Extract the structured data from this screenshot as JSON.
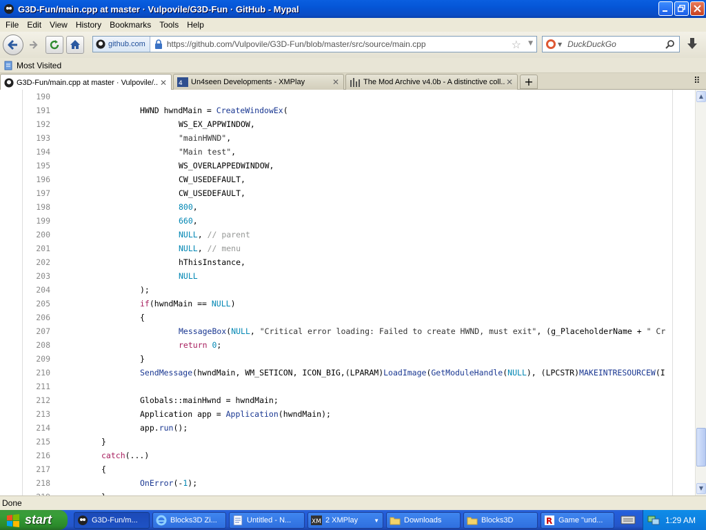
{
  "window": {
    "title": "G3D-Fun/main.cpp at master · Vulpovile/G3D-Fun · GitHub - Mypal"
  },
  "menu": [
    "File",
    "Edit",
    "View",
    "History",
    "Bookmarks",
    "Tools",
    "Help"
  ],
  "nav": {
    "identity": "github.com",
    "url": "https://github.com/Vulpovile/G3D-Fun/blob/master/src/source/main.cpp",
    "search_placeholder": "DuckDuckGo"
  },
  "bookmarks": {
    "most_visited": "Most Visited"
  },
  "tabs": [
    {
      "label": "G3D-Fun/main.cpp at master · Vulpovile/...",
      "active": true
    },
    {
      "label": "Un4seen Developments - XMPlay",
      "active": false
    },
    {
      "label": "The Mod Archive v4.0b - A distinctive coll...",
      "active": false
    }
  ],
  "code": [
    {
      "n": "190",
      "i": 0,
      "t": []
    },
    {
      "n": "191",
      "i": 2,
      "t": [
        [
          "",
          "HWND hwndMain = "
        ],
        [
          "fn",
          "CreateWindowEx"
        ],
        [
          "",
          "("
        ]
      ]
    },
    {
      "n": "192",
      "i": 3,
      "t": [
        [
          "",
          "WS_EX_APPWINDOW,"
        ]
      ]
    },
    {
      "n": "193",
      "i": 3,
      "t": [
        [
          "str",
          "\"mainHWND\""
        ],
        [
          "",
          ","
        ]
      ]
    },
    {
      "n": "194",
      "i": 3,
      "t": [
        [
          "str",
          "\"Main test\""
        ],
        [
          "",
          ","
        ]
      ]
    },
    {
      "n": "195",
      "i": 3,
      "t": [
        [
          "",
          "WS_OVERLAPPEDWINDOW,"
        ]
      ]
    },
    {
      "n": "196",
      "i": 3,
      "t": [
        [
          "",
          "CW_USEDEFAULT,"
        ]
      ]
    },
    {
      "n": "197",
      "i": 3,
      "t": [
        [
          "",
          "CW_USEDEFAULT,"
        ]
      ]
    },
    {
      "n": "198",
      "i": 3,
      "t": [
        [
          "fnc",
          "800"
        ],
        [
          "",
          ","
        ]
      ]
    },
    {
      "n": "199",
      "i": 3,
      "t": [
        [
          "fnc",
          "660"
        ],
        [
          "",
          ","
        ]
      ]
    },
    {
      "n": "200",
      "i": 3,
      "t": [
        [
          "fnc",
          "NULL"
        ],
        [
          "",
          ", "
        ],
        [
          "cm",
          "// parent"
        ]
      ]
    },
    {
      "n": "201",
      "i": 3,
      "t": [
        [
          "fnc",
          "NULL"
        ],
        [
          "",
          ", "
        ],
        [
          "cm",
          "// menu"
        ]
      ]
    },
    {
      "n": "202",
      "i": 3,
      "t": [
        [
          "",
          "hThisInstance,"
        ]
      ]
    },
    {
      "n": "203",
      "i": 3,
      "t": [
        [
          "fnc",
          "NULL"
        ]
      ]
    },
    {
      "n": "204",
      "i": 2,
      "t": [
        [
          "",
          ");"
        ]
      ]
    },
    {
      "n": "205",
      "i": 2,
      "t": [
        [
          "kw",
          "if"
        ],
        [
          "",
          "(hwndMain == "
        ],
        [
          "fnc",
          "NULL"
        ],
        [
          "",
          ")"
        ]
      ]
    },
    {
      "n": "206",
      "i": 2,
      "t": [
        [
          "",
          "{"
        ]
      ]
    },
    {
      "n": "207",
      "i": 3,
      "t": [
        [
          "fn",
          "MessageBox"
        ],
        [
          "",
          "("
        ],
        [
          "fnc",
          "NULL"
        ],
        [
          "",
          ", "
        ],
        [
          "str",
          "\"Critical error loading: Failed to create HWND, must exit\""
        ],
        [
          "",
          ", (g_PlaceholderName + "
        ],
        [
          "str",
          "\" Cr"
        ]
      ]
    },
    {
      "n": "208",
      "i": 3,
      "t": [
        [
          "kw",
          "return"
        ],
        [
          "fnc",
          " 0"
        ],
        [
          "",
          ";"
        ]
      ]
    },
    {
      "n": "209",
      "i": 2,
      "t": [
        [
          "",
          "}"
        ]
      ]
    },
    {
      "n": "210",
      "i": 2,
      "t": [
        [
          "fn",
          "SendMessage"
        ],
        [
          "",
          "(hwndMain, WM_SETICON, ICON_BIG,(LPARAM)"
        ],
        [
          "fn",
          "LoadImage"
        ],
        [
          "",
          "("
        ],
        [
          "fn",
          "GetModuleHandle"
        ],
        [
          "",
          "("
        ],
        [
          "fnc",
          "NULL"
        ],
        [
          "",
          "), (LPCSTR)"
        ],
        [
          "fn",
          "MAKEINTRESOURCEW"
        ],
        [
          "",
          "(I"
        ]
      ]
    },
    {
      "n": "211",
      "i": 0,
      "t": []
    },
    {
      "n": "212",
      "i": 2,
      "t": [
        [
          "",
          "Globals::mainHwnd = hwndMain;"
        ]
      ]
    },
    {
      "n": "213",
      "i": 2,
      "t": [
        [
          "",
          "Application app = "
        ],
        [
          "fn",
          "Application"
        ],
        [
          "",
          "(hwndMain);"
        ]
      ]
    },
    {
      "n": "214",
      "i": 2,
      "t": [
        [
          "",
          "app."
        ],
        [
          "fn",
          "run"
        ],
        [
          "",
          "();"
        ]
      ]
    },
    {
      "n": "215",
      "i": 1,
      "t": [
        [
          "",
          "}"
        ]
      ]
    },
    {
      "n": "216",
      "i": 1,
      "t": [
        [
          "kw",
          "catch"
        ],
        [
          "",
          "(...)"
        ]
      ]
    },
    {
      "n": "217",
      "i": 1,
      "t": [
        [
          "",
          "{"
        ]
      ]
    },
    {
      "n": "218",
      "i": 2,
      "t": [
        [
          "fn",
          "OnError"
        ],
        [
          "",
          "(-"
        ],
        [
          "fnc",
          "1"
        ],
        [
          "",
          ");"
        ]
      ]
    },
    {
      "n": "219",
      "i": 1,
      "t": [
        [
          "",
          "}"
        ]
      ]
    }
  ],
  "status": "Done",
  "taskbar": {
    "start": "start",
    "items": [
      {
        "label": "G3D-Fun/m...",
        "active": true
      },
      {
        "label": "Blocks3D Zi...",
        "active": false
      },
      {
        "label": "Untitled - N...",
        "active": false
      },
      {
        "label": "2 XMPlay",
        "active": false
      },
      {
        "label": "Downloads",
        "active": false
      },
      {
        "label": "Blocks3D",
        "active": false
      },
      {
        "label": "Game \"und...",
        "active": false
      }
    ],
    "clock": "1:29 AM"
  },
  "colors": {
    "titlebar": "#0a4cc4",
    "keyword": "#a71d5d",
    "function": "#183691",
    "constant": "#0086b3",
    "comment": "#969896"
  }
}
